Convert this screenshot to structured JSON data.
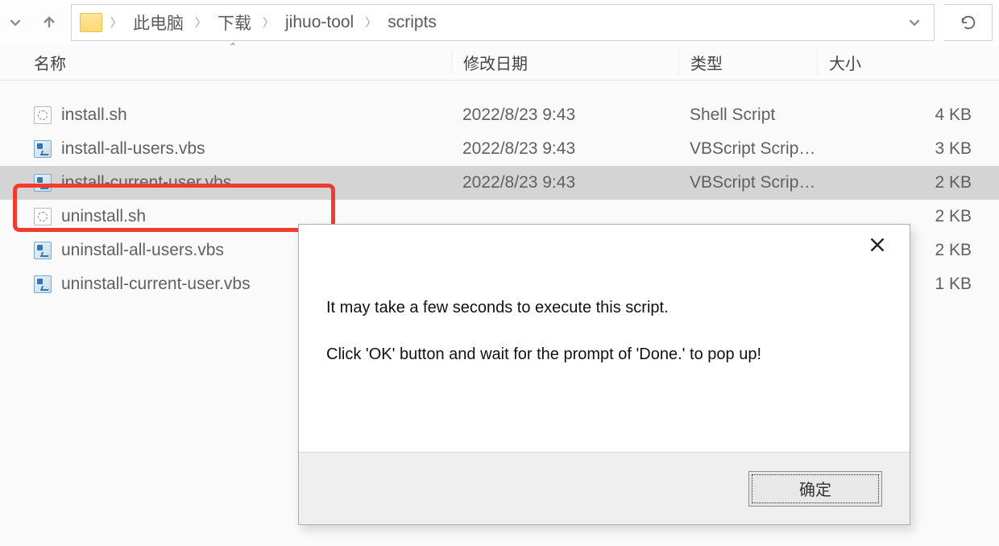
{
  "nav": {
    "breadcrumbs": [
      "此电脑",
      "下载",
      "jihuo-tool",
      "scripts"
    ]
  },
  "columns": {
    "name": "名称",
    "date": "修改日期",
    "type": "类型",
    "size": "大小"
  },
  "files": [
    {
      "name": "install.sh",
      "date": "2022/8/23 9:43",
      "type": "Shell Script",
      "size": "4 KB",
      "icon": "sh",
      "selected": false
    },
    {
      "name": "install-all-users.vbs",
      "date": "2022/8/23 9:43",
      "type": "VBScript Script ...",
      "size": "3 KB",
      "icon": "vbs",
      "selected": false
    },
    {
      "name": "install-current-user.vbs",
      "date": "2022/8/23 9:43",
      "type": "VBScript Script ...",
      "size": "2 KB",
      "icon": "vbs",
      "selected": true
    },
    {
      "name": "uninstall.sh",
      "date": "",
      "type": "",
      "size": "2 KB",
      "icon": "sh",
      "selected": false
    },
    {
      "name": "uninstall-all-users.vbs",
      "date": "",
      "type": "",
      "size": "2 KB",
      "icon": "vbs",
      "selected": false
    },
    {
      "name": "uninstall-current-user.vbs",
      "date": "",
      "type": "",
      "size": "1 KB",
      "icon": "vbs",
      "selected": false
    }
  ],
  "dialog": {
    "line1": "It may take a few seconds to execute this script.",
    "line2": "Click 'OK' button and wait for the prompt of 'Done.' to pop up!",
    "ok_label": "确定"
  }
}
